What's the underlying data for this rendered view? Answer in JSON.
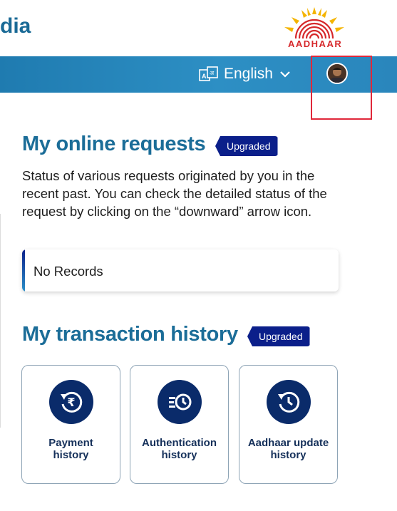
{
  "header": {
    "title_fragment": "dia",
    "logo_text": "AADHAAR"
  },
  "nav": {
    "language": "English"
  },
  "requests": {
    "title": "My online requests",
    "badge": "Upgraded",
    "description": "Status of various requests originated by you in the recent past. You can check the detailed status of the request by clicking on the “downward” arrow icon.",
    "empty_text": "No Records"
  },
  "transactions": {
    "title": "My transaction history",
    "badge": "Upgraded",
    "tiles": [
      {
        "label_line1": "Payment",
        "label_line2": "history",
        "icon": "rupee-history-icon"
      },
      {
        "label_line1": "Authentication",
        "label_line2": "history",
        "icon": "auth-history-icon"
      },
      {
        "label_line1": "Aadhaar update",
        "label_line2": "history",
        "icon": "update-history-icon"
      }
    ]
  },
  "colors": {
    "heading": "#1b6d98",
    "nav_bar": "#2a86bc",
    "badge": "#0b1f8a",
    "tile_icon_bg": "#0a2b6a",
    "highlight": "#e0283a"
  }
}
